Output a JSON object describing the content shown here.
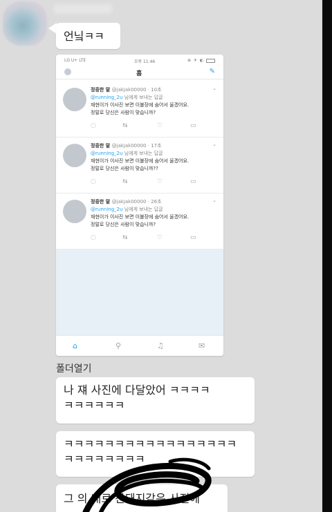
{
  "sender": {
    "name": ""
  },
  "messages": [
    {
      "id": "b1",
      "text": "언닠ㅋㅋ"
    },
    {
      "id": "b3",
      "text": "나 쟤 사진에 다달았어 ㅋㅋㅋㅋ\nㅋㅋㅋㅋㅋㅋ"
    },
    {
      "id": "b4",
      "text": "ㅋㅋㅋㅋㅋㅋㅋㅋㅋㅋㅋㅋㅋㅋㅋㅋㅋ\nㅋㅋㅋㅋㅋㅋㅋㅋ"
    },
    {
      "id": "b5",
      "text": "그 의 대로 산돼지같은 사진에"
    }
  ],
  "folder_label": "폴더열기",
  "screenshot": {
    "status": {
      "carrier": "LG U+ LTE",
      "time": "오후 11:46",
      "right": "⊕ ✈ ◐"
    },
    "header_title": "홈",
    "compose_icon": "✎",
    "tweets": [
      {
        "name": "정중한 말",
        "handle": "@jakjak00000 · 10초",
        "reply_to": "@running_2u",
        "reply_suffix": " 님에게 보내는 답글",
        "line1": "재현이가 이사진 보면 이불장에 숨어서 울겠어요.",
        "line2": "정말로 당신은 사람이 맞습니까?"
      },
      {
        "name": "정중한 말",
        "handle": "@jakjak00000 · 17초",
        "reply_to": "@running_2u",
        "reply_suffix": " 님에게 보내는 답글",
        "line1": "재현이가 이사진 보면 이불장에 숨어서 울겠어요.",
        "line2": "정말로 당신은 사람이 맞습니까??"
      },
      {
        "name": "정중한 말",
        "handle": "@jakjak00000 · 26초",
        "reply_to": "@running_2u",
        "reply_suffix": " 님에게 보내는 답글",
        "line1": "재현이가 이사진 보면 이불장에 숨어서 울겠어요.",
        "line2": "정말로 당신은 사람이 맞습니까?"
      }
    ],
    "action_icons": {
      "reply": "◌",
      "retweet": "⇆",
      "like": "♡",
      "share": "▭"
    },
    "tab_icons": {
      "home": "⌂",
      "search": "⚲",
      "notifications": "♫",
      "messages": "✉"
    }
  },
  "colors": {
    "background": "#dcdcdc",
    "bubble": "#ffffff",
    "accent": "#1da1f2",
    "scribble": "#000000"
  }
}
